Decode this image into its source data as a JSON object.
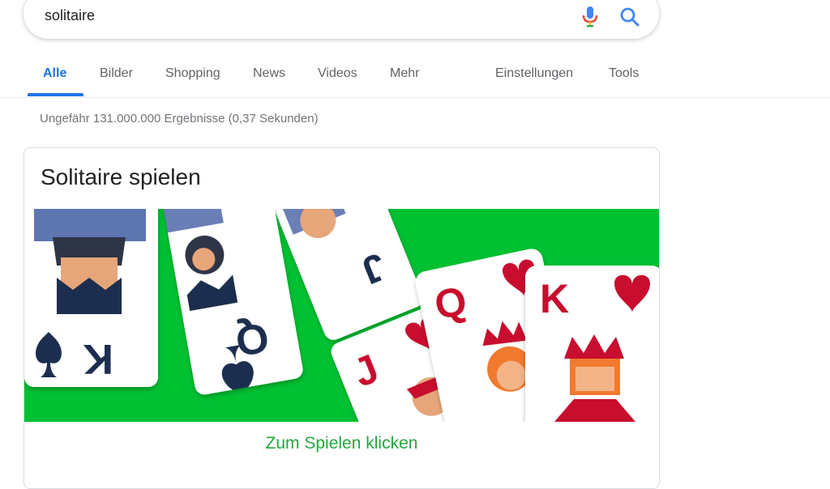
{
  "search": {
    "query": "solitaire"
  },
  "tabs": [
    {
      "label": "Alle",
      "active": true
    },
    {
      "label": "Bilder"
    },
    {
      "label": "Shopping"
    },
    {
      "label": "News"
    },
    {
      "label": "Videos"
    },
    {
      "label": "Mehr"
    }
  ],
  "tools": {
    "settings_label": "Einstellungen",
    "tools_label": "Tools"
  },
  "result_stats": "Ungefähr 131.000.000 Ergebnisse (0,37 Sekunden)",
  "card": {
    "title": "Solitaire spielen",
    "play_label": "Zum Spielen klicken",
    "cards": [
      {
        "rank": "K",
        "suit": "spade"
      },
      {
        "rank": "Q",
        "suit": "spade"
      },
      {
        "rank": "J",
        "suit": "spade"
      },
      {
        "rank": "J",
        "suit": "heart"
      },
      {
        "rank": "Q",
        "suit": "heart"
      },
      {
        "rank": "K",
        "suit": "heart"
      }
    ]
  },
  "colors": {
    "accent": "#1a73e8",
    "felt": "#00c132",
    "play_link": "#24a73f",
    "card_red": "#c8102e",
    "card_navy": "#1f2d4f"
  }
}
